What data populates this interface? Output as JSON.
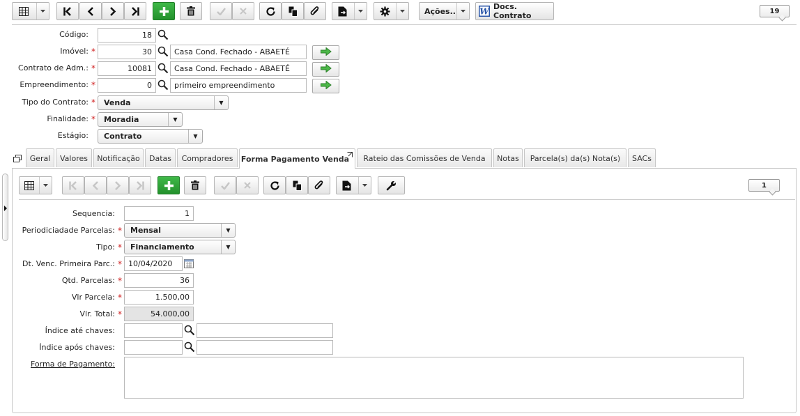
{
  "toolbar": {
    "record_count": "19",
    "actions_label": "Ações..",
    "docs_label": "Docs. Contrato"
  },
  "form": {
    "codigo_label": "Código:",
    "codigo_value": "18",
    "imovel_label": "Imóvel:",
    "imovel_code": "30",
    "imovel_desc": "Casa Cond. Fechado - ABAETÉ",
    "contrato_adm_label": "Contrato de Adm.:",
    "contrato_adm_code": "10081",
    "contrato_adm_desc": "Casa Cond. Fechado - ABAETÉ",
    "empreendimento_label": "Empreendimento:",
    "empreendimento_code": "0",
    "empreendimento_desc": "primeiro empreendimento",
    "tipo_contrato_label": "Tipo do Contrato:",
    "tipo_contrato_value": "Venda",
    "finalidade_label": "Finalidade:",
    "finalidade_value": "Moradia",
    "estagio_label": "Estágio:",
    "estagio_value": "Contrato",
    "required_mark": "*"
  },
  "tabs": [
    {
      "label": "Geral"
    },
    {
      "label": "Valores"
    },
    {
      "label": "Notificação"
    },
    {
      "label": "Datas"
    },
    {
      "label": "Compradores"
    },
    {
      "label": "Forma Pagamento Venda"
    },
    {
      "label": "Rateio das Comissões de Venda"
    },
    {
      "label": "Notas"
    },
    {
      "label": "Parcela(s) da(s) Nota(s)"
    },
    {
      "label": "SACs"
    }
  ],
  "subtoolbar": {
    "record_count": "1"
  },
  "payment": {
    "sequencia_label": "Sequencia:",
    "sequencia_value": "1",
    "periodicidade_label": "Periodiciadade Parcelas:",
    "periodicidade_value": "Mensal",
    "tipo_label": "Tipo:",
    "tipo_value": "Financiamento",
    "dt_venc_label": "Dt. Venc. Primeira Parc.:",
    "dt_venc_value": "10/04/2020",
    "qtd_parcelas_label": "Qtd. Parcelas:",
    "qtd_parcelas_value": "36",
    "vlr_parcela_label": "Vlr Parcela:",
    "vlr_parcela_value": "1.500,00",
    "vlr_total_label": "Vlr. Total:",
    "vlr_total_value": "54.000,00",
    "indice_ate_label": "Índice até chaves:",
    "indice_ate_value": "",
    "indice_apos_label": "Índice após chaves:",
    "indice_apos_value": "",
    "forma_pagamento_label": "Forma de Pagamento:",
    "forma_pagamento_value": ""
  },
  "colors": {
    "accent_green": "#2aa534",
    "required_red": "#d02020",
    "border_gray": "#c6c6c6"
  }
}
